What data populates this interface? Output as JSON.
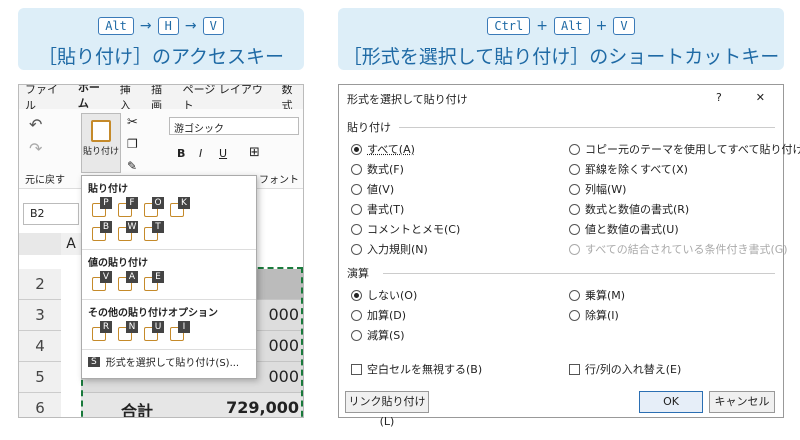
{
  "left_header": {
    "keys": [
      "Alt",
      "H",
      "V"
    ],
    "arrow": "→",
    "title": "［貼り付け］のアクセスキー"
  },
  "right_header": {
    "keys": [
      "Ctrl",
      "Alt",
      "V"
    ],
    "plus": "+",
    "title": "［形式を選択して貼り付け］のショートカットキー"
  },
  "excel": {
    "tabs": [
      "ファイル",
      "ホーム",
      "挿入",
      "描画",
      "ページ レイアウト",
      "数式"
    ],
    "paste_label": "貼り付け",
    "undo_label": "元に戻す",
    "font_name": "游ゴシック",
    "font_group": "フォント",
    "name_box": "B2",
    "col_a": "A",
    "rows": [
      {
        "n": "2",
        "v": ""
      },
      {
        "n": "3",
        "v": "000"
      },
      {
        "n": "4",
        "v": "000"
      },
      {
        "n": "5",
        "v": "000"
      },
      {
        "n": "6",
        "v": "729,000",
        "label": "合計"
      }
    ],
    "menu": {
      "sec1": "貼り付け",
      "row1": [
        "P",
        "F",
        "O",
        "K"
      ],
      "row2": [
        "B",
        "W",
        "T"
      ],
      "sec2": "値の貼り付け",
      "row3": [
        "V",
        "A",
        "E"
      ],
      "sec3": "その他の貼り付けオプション",
      "row4": [
        "R",
        "N",
        "U",
        "I"
      ],
      "special_key": "S",
      "special_label": "形式を選択して貼り付け(S)..."
    }
  },
  "dialog": {
    "title": "形式を選択して貼り付け",
    "help": "?",
    "close": "✕",
    "paste_section": "貼り付け",
    "paste_left": [
      "すべて(A)",
      "数式(F)",
      "値(V)",
      "書式(T)",
      "コメントとメモ(C)",
      "入力規則(N)"
    ],
    "paste_right": [
      "コピー元のテーマを使用してすべて貼り付け(H)",
      "罫線を除くすべて(X)",
      "列幅(W)",
      "数式と数値の書式(R)",
      "値と数値の書式(U)",
      "すべての結合されている条件付き書式(G)"
    ],
    "op_section": "演算",
    "op_left": [
      "しない(O)",
      "加算(D)",
      "減算(S)"
    ],
    "op_right": [
      "乗算(M)",
      "除算(I)"
    ],
    "skip_blanks": "空白セルを無視する(B)",
    "transpose": "行/列の入れ替え(E)",
    "link_button": "リンク貼り付け(L)",
    "ok": "OK",
    "cancel": "キャンセル"
  }
}
